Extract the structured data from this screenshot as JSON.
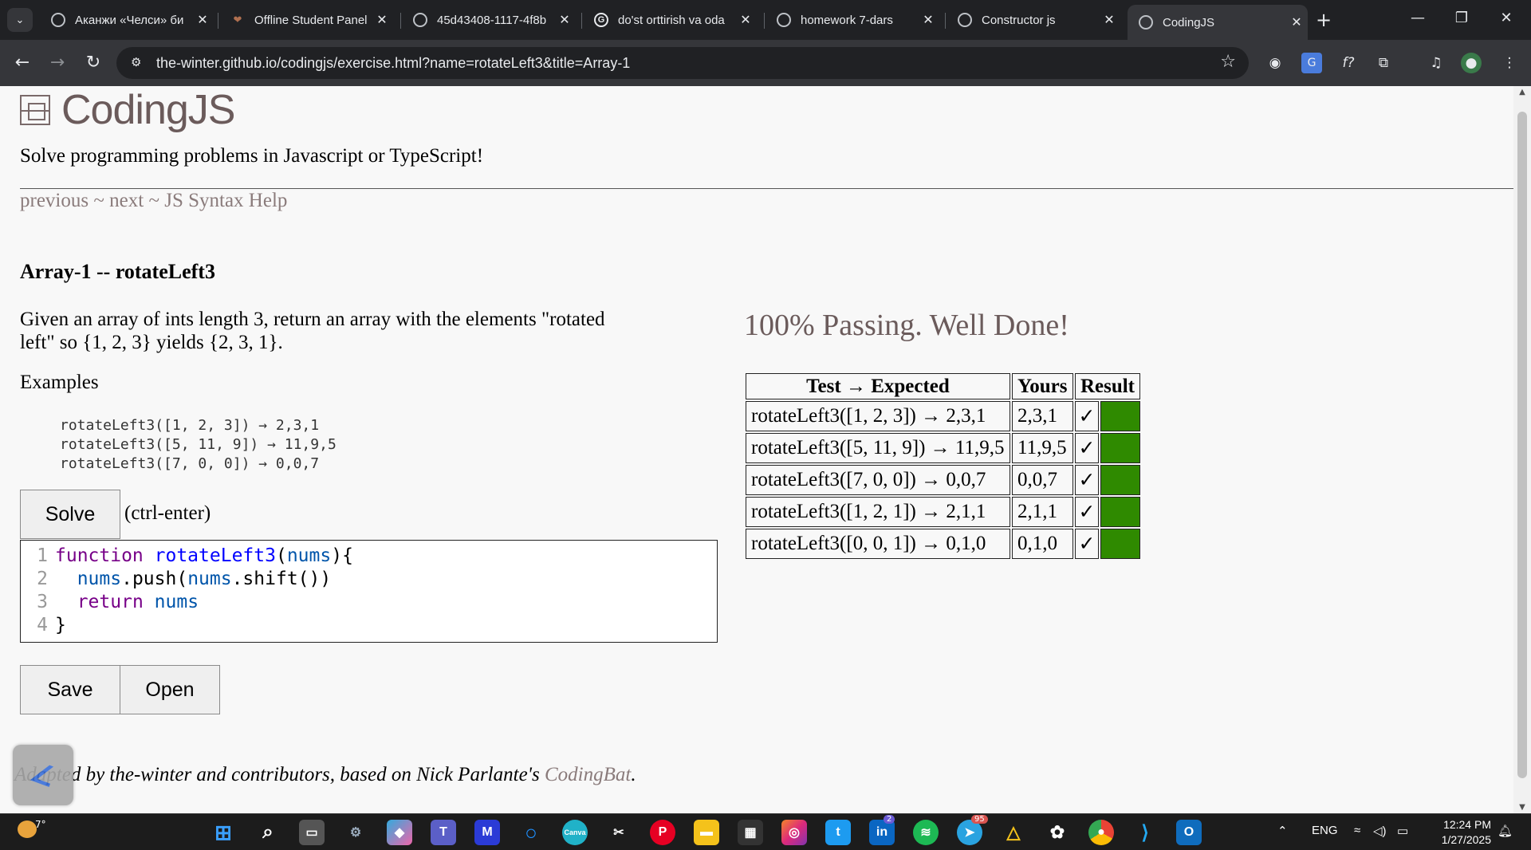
{
  "browser": {
    "tabs": [
      {
        "title": "Аканжи «Челси» би",
        "favicon": "globe-icon"
      },
      {
        "title": "Offline Student Panel",
        "favicon": "heart-icon"
      },
      {
        "title": "45d43408-1117-4f8b",
        "favicon": "globe-icon"
      },
      {
        "title": "do'st orttirish va oda",
        "favicon": "google-icon"
      },
      {
        "title": "homework 7-dars",
        "favicon": "globe-icon"
      },
      {
        "title": "Constructor js",
        "favicon": "globe-icon"
      },
      {
        "title": "CodingJS",
        "favicon": "globe-icon",
        "active": true
      }
    ],
    "url_host": "the-winter.github.io",
    "url_path": "/codingjs/exercise.html?name=rotateLeft3&title=Array-1"
  },
  "page": {
    "logo_text": "CodingJS",
    "tagline": "Solve programming problems in Javascript or TypeScript!",
    "nav": {
      "previous": "previous",
      "sep1": " ~ ",
      "next": "next",
      "sep2": " ~ ",
      "help": "JS Syntax Help"
    },
    "problem_title": "Array-1 -- rotateLeft3",
    "description": "Given an array of ints length 3, return an array with the elements \"rotated left\" so {1, 2, 3} yields {2, 3, 1}.",
    "examples_heading": "Examples",
    "examples": [
      "rotateLeft3([1, 2, 3]) → 2,3,1",
      "rotateLeft3([5, 11, 9]) → 11,9,5",
      "rotateLeft3([7, 0, 0]) → 0,0,7"
    ],
    "solve_label": "Solve",
    "solve_hint": "(ctrl-enter)",
    "code": {
      "line_numbers": [
        "1",
        "2",
        "3",
        "4"
      ],
      "l1_kw": "function",
      "l1_fn": "rotateLeft3",
      "l1_open": "(",
      "l1_arg": "nums",
      "l1_close": "){",
      "l2_a": "nums",
      "l2_b": ".push(",
      "l2_c": "nums",
      "l2_d": ".shift())",
      "l3_kw": "return",
      "l3_var": "nums",
      "l4": "}"
    },
    "save_label": "Save",
    "open_label": "Open",
    "passing_text": "100% Passing. Well Done!",
    "results": {
      "headers": [
        "Test → Expected",
        "Yours",
        "Result"
      ],
      "rows": [
        {
          "test": "rotateLeft3([1, 2, 3]) → 2,3,1",
          "yours": "2,3,1",
          "mark": "✓"
        },
        {
          "test": "rotateLeft3([5, 11, 9]) → 11,9,5",
          "yours": "11,9,5",
          "mark": "✓"
        },
        {
          "test": "rotateLeft3([7, 0, 0]) → 0,0,7",
          "yours": "0,0,7",
          "mark": "✓"
        },
        {
          "test": "rotateLeft3([1, 2, 1]) → 2,1,1",
          "yours": "2,1,1",
          "mark": "✓"
        },
        {
          "test": "rotateLeft3([0, 0, 1]) → 0,1,0",
          "yours": "0,1,0",
          "mark": "✓"
        }
      ],
      "pass_color": "#2f8a00"
    },
    "footer_text": "Adapted by the-winter and contributors, based on Nick Parlante's ",
    "footer_link": "CodingBat",
    "footer_end": "."
  },
  "taskbar": {
    "weather_temp": "7°",
    "telegram_badge": "95",
    "linkedin_badge": "2",
    "language": "ENG",
    "time": "12:24 PM",
    "date": "1/27/2025"
  }
}
